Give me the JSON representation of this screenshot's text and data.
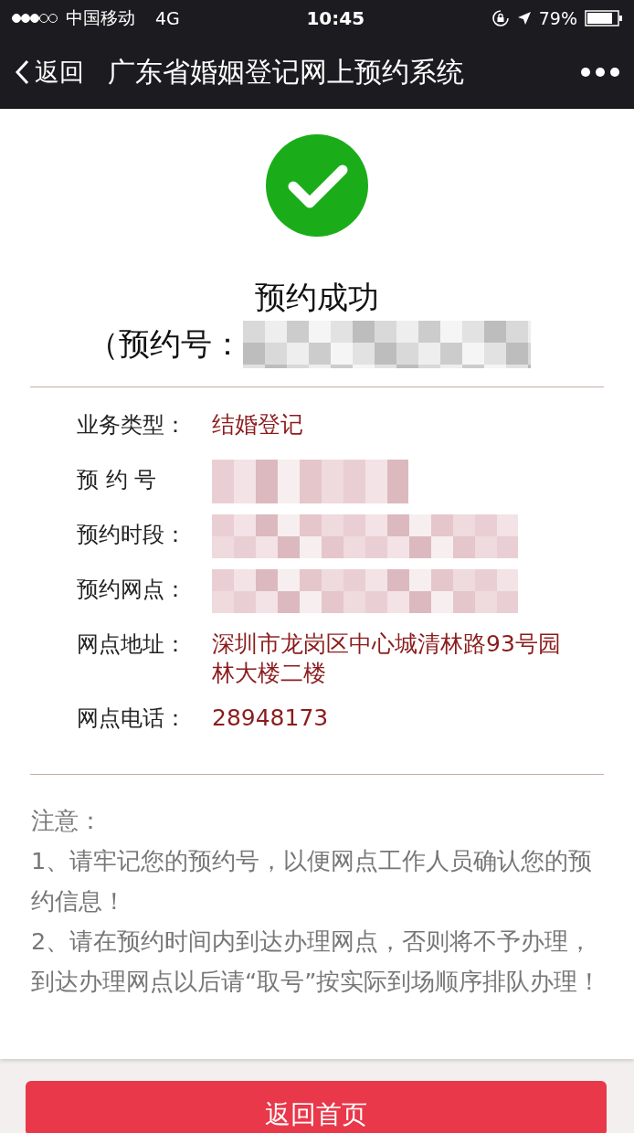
{
  "status_bar": {
    "carrier": "中国移动",
    "network": "4G",
    "time": "10:45",
    "battery": "79%"
  },
  "nav": {
    "back": "返回",
    "title": "广东省婚姻登记网上预约系统"
  },
  "result": {
    "title": "预约成功",
    "number_label": "（预约号："
  },
  "details": [
    {
      "label": "业务类型：",
      "kind": "text",
      "value": "结婚登记"
    },
    {
      "label": "预 约 号",
      "kind": "redacted"
    },
    {
      "label": "预约时段：",
      "kind": "redacted"
    },
    {
      "label": "预约网点：",
      "kind": "redacted"
    },
    {
      "label": "网点地址：",
      "kind": "text",
      "value": "深圳市龙岗区中心城清林路93号园林大楼二楼"
    },
    {
      "label": "网点电话：",
      "kind": "text",
      "value": "28948173"
    }
  ],
  "notes": {
    "heading": "注意：",
    "items": [
      "1、请牢记您的预约号，以便网点工作人员确认您的预约信息！",
      "2、请在预约时间内到达办理网点，否则将不予办理，到达办理网点以后请“取号”按实际到场顺序排队办理！"
    ]
  },
  "home_button": "返回首页"
}
